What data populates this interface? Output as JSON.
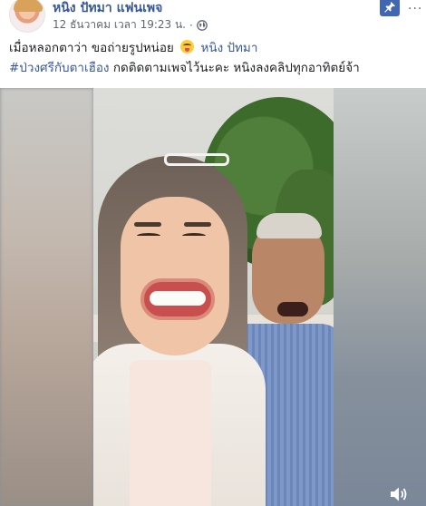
{
  "post": {
    "page_name": "หนิง ปัทมา แฟนเพจ",
    "timestamp": "12 ธันวาคม เวลา 19:23 น.",
    "separator": "·",
    "caption_line1_text": "เมื่อหลอกตาว่า ขอถ่ายรูปหน่อย",
    "caption_mention": "หนิง ปัทมา",
    "caption_hashtag": "#ป่วงศรีกับตาเฮือง",
    "caption_line2_text": "กดติดตามเพจไว้นะคะ หนิงลงคลิปทุกอาทิตย์จ้า",
    "more_label": "···"
  },
  "icons": {
    "globe": "globe-icon",
    "pin": "pin-icon",
    "emoji": "tongue-wink-emoji",
    "volume": "volume-icon"
  },
  "colors": {
    "link": "#385898",
    "pin_bg": "#4267b2",
    "meta_text": "#606770"
  }
}
